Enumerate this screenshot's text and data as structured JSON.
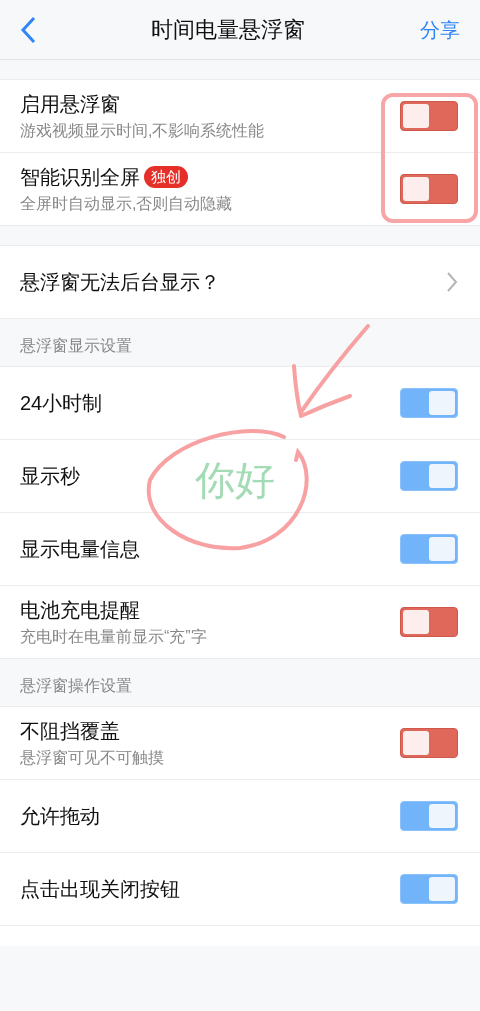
{
  "nav": {
    "title": "时间电量悬浮窗",
    "action": "分享"
  },
  "groups": [
    {
      "items": [
        {
          "kind": "toggle",
          "label": "启用悬浮窗",
          "subtitle": "游戏视频显示时间,不影响系统性能",
          "on": false
        },
        {
          "kind": "toggle",
          "label": "智能识别全屏",
          "badge": "独创",
          "subtitle": "全屏时自动显示,否则自动隐藏",
          "on": false
        }
      ]
    },
    {
      "items": [
        {
          "kind": "link",
          "label": "悬浮窗无法后台显示？"
        }
      ]
    },
    {
      "header": "悬浮窗显示设置",
      "items": [
        {
          "kind": "toggle",
          "label": "24小时制",
          "on": true
        },
        {
          "kind": "toggle",
          "label": "显示秒",
          "on": true
        },
        {
          "kind": "toggle",
          "label": "显示电量信息",
          "on": true
        },
        {
          "kind": "toggle",
          "label": "电池充电提醒",
          "subtitle": "充电时在电量前显示“充”字",
          "on": false
        }
      ]
    },
    {
      "header": "悬浮窗操作设置",
      "items": [
        {
          "kind": "toggle",
          "label": "不阻挡覆盖",
          "subtitle": "悬浮窗可见不可触摸",
          "on": false
        },
        {
          "kind": "toggle",
          "label": "允许拖动",
          "on": true
        },
        {
          "kind": "toggle",
          "label": "点击出现关闭按钮",
          "on": true
        }
      ]
    }
  ],
  "annotation": {
    "text": "你好"
  }
}
